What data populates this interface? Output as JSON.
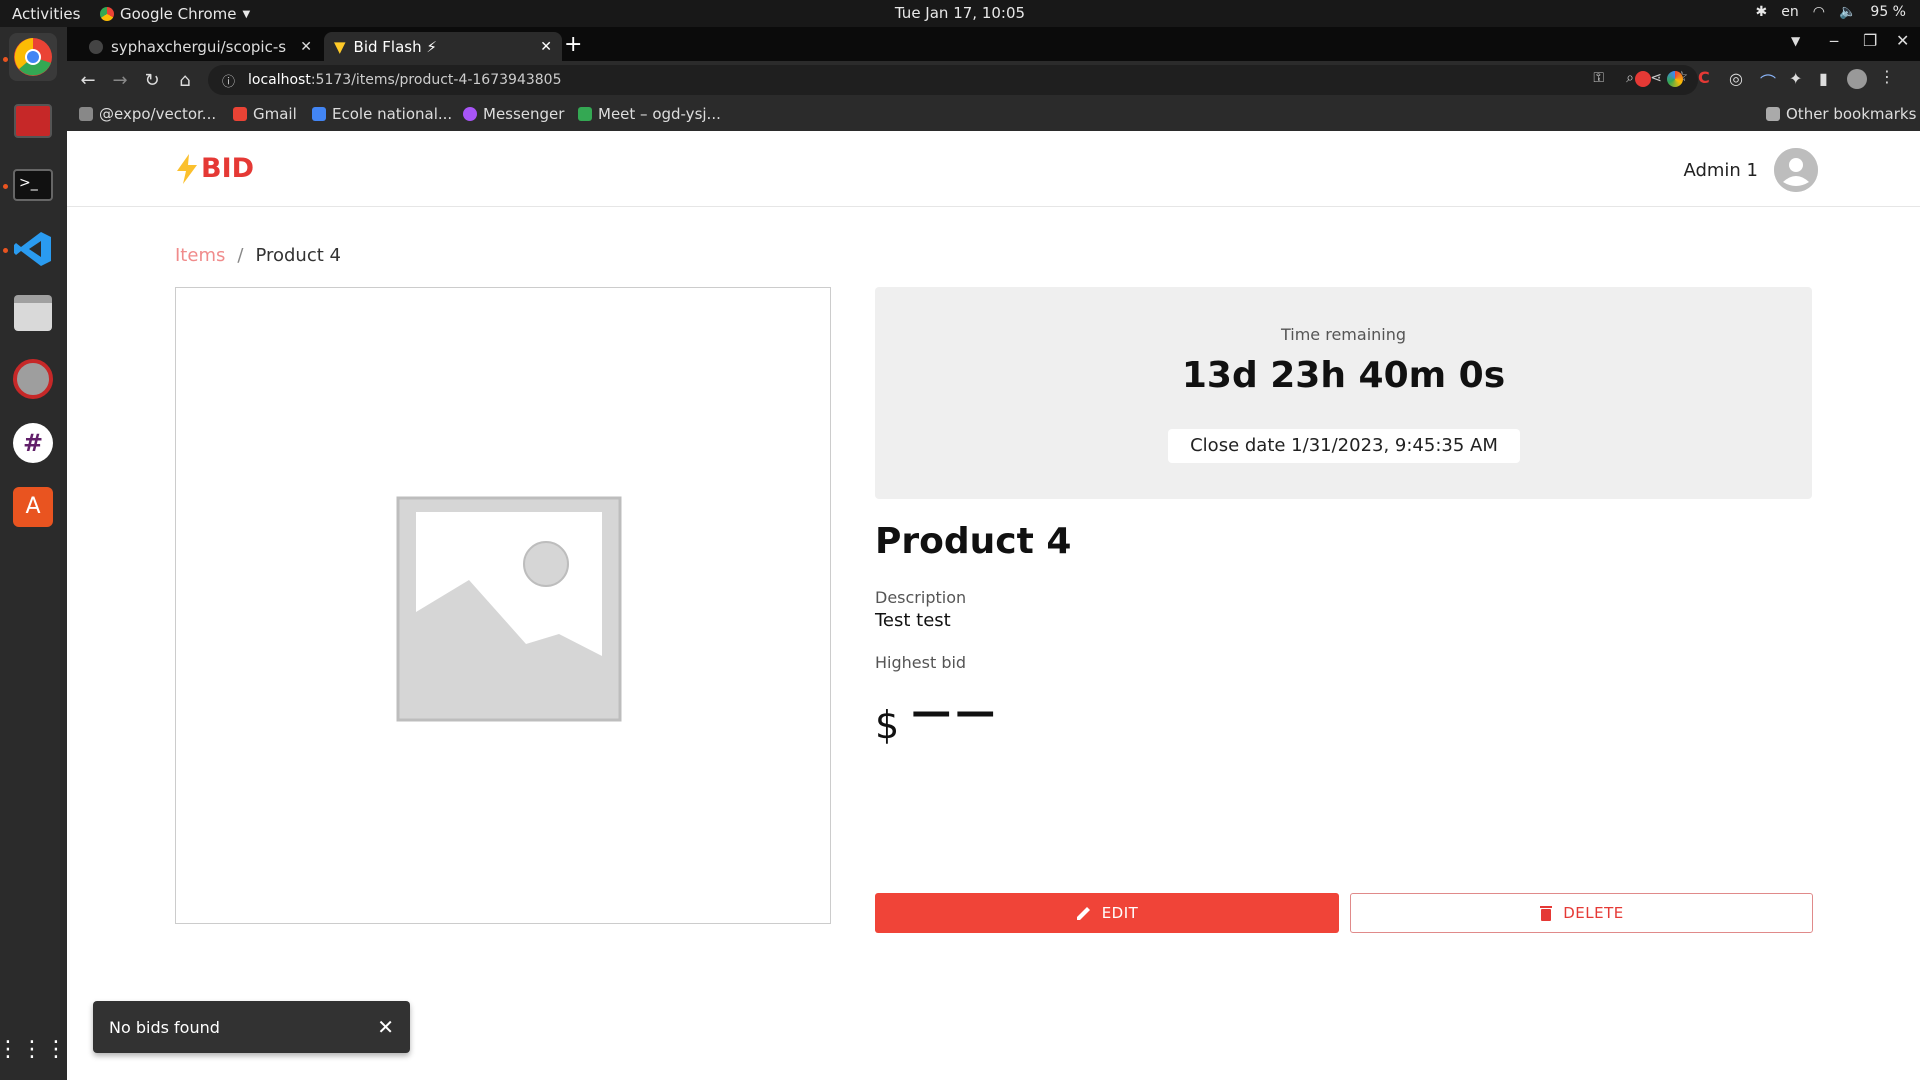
{
  "system": {
    "activities": "Activities",
    "app_name": "Google Chrome",
    "clock": "Tue Jan 17, 10:05",
    "lang": "en",
    "battery": "95 %"
  },
  "browser": {
    "tabs": [
      {
        "title": "syphaxchergui/scopic-sof",
        "active": false
      },
      {
        "title": "Bid Flash ⚡",
        "active": true
      }
    ],
    "url_host": "localhost",
    "url_rest": ":5173/items/product-4-1673943805",
    "bookmarks": [
      "@expo/vector...",
      "Gmail",
      "Ecole national...",
      "Messenger",
      "Meet – ogd-ysj..."
    ],
    "other_bookmarks": "Other bookmarks"
  },
  "app": {
    "logo_text": "BID",
    "logo_icon": "lightning-icon",
    "user_name": "Admin 1",
    "breadcrumb": {
      "parent": "Items",
      "separator": "/",
      "current": "Product 4"
    },
    "timer": {
      "label": "Time remaining",
      "value": "13d 23h 40m 0s",
      "close_date": "Close date 1/31/2023, 9:45:35 AM"
    },
    "product": {
      "title": "Product 4",
      "description_label": "Description",
      "description": "Test test",
      "highest_bid_label": "Highest bid",
      "currency": "$",
      "highest_bid": "——"
    },
    "buttons": {
      "edit": "EDIT",
      "delete": "DELETE"
    },
    "snackbar": {
      "message": "No bids found"
    },
    "colors": {
      "accent": "#f04438",
      "brand": "#e53935"
    }
  }
}
